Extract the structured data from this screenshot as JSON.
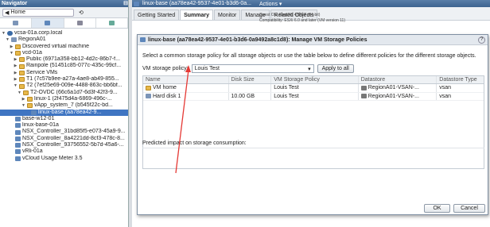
{
  "navigator": {
    "title": "Navigator",
    "home_label": "Home",
    "tree": [
      {
        "label": "vcsa-01a.corp.local",
        "icon": "vcenter-icon",
        "indent": 0,
        "expand": "▼"
      },
      {
        "label": "RegionA01",
        "icon": "datacenter-icon",
        "indent": 1,
        "expand": "▼"
      },
      {
        "label": "Discovered virtual machine",
        "icon": "folder-icon",
        "indent": 2,
        "expand": "▶"
      },
      {
        "label": "vcd-01a",
        "icon": "folder-icon",
        "indent": 2,
        "expand": "▼"
      },
      {
        "label": "Public (6971a358-bb12-4d2c-86b7-f...",
        "icon": "folder-icon",
        "indent": 3,
        "expand": "▶"
      },
      {
        "label": "Rainpole (51451c85-077c-435c-99cf...",
        "icon": "folder-icon",
        "indent": 3,
        "expand": "▶"
      },
      {
        "label": "Service VMs",
        "icon": "folder-icon",
        "indent": 3,
        "expand": "▶"
      },
      {
        "label": "T1 (7c57b9ee-a27a-4ae8-ab49-855...",
        "icon": "folder-icon",
        "indent": 3,
        "expand": "▶"
      },
      {
        "label": "T2 (7ef25e69-009e-4488-863c-bb6bf...",
        "icon": "folder-icon",
        "indent": 3,
        "expand": "▼"
      },
      {
        "label": "T2-OVDC (66c6a1d7-6d3f-42f3-9...",
        "icon": "folder-icon",
        "indent": 4,
        "expand": "▼"
      },
      {
        "label": "linux-1 (2f475d4a-6869-496c-...",
        "icon": "folder-icon",
        "indent": 5,
        "expand": "▶"
      },
      {
        "label": "vApp_system_7 (b545f22c-bd...",
        "icon": "folder-icon",
        "indent": 5,
        "expand": "▼"
      },
      {
        "label": "linux-base (aa78ea42-9...",
        "icon": "vm-icon",
        "indent": 6,
        "expand": "",
        "selected": true
      },
      {
        "label": "base-w12-01",
        "icon": "vm-icon",
        "indent": 2,
        "expand": ""
      },
      {
        "label": "linux-base-01a",
        "icon": "vm-icon",
        "indent": 2,
        "expand": ""
      },
      {
        "label": "NSX_Controller_31bd85f5-e073-45a9-9...",
        "icon": "vm-icon",
        "indent": 2,
        "expand": ""
      },
      {
        "label": "NSX_Controller_8a4221dd-8cf3-478c-8...",
        "icon": "vm-icon",
        "indent": 2,
        "expand": ""
      },
      {
        "label": "NSX_Controller_93756552-5b7d-45a6-...",
        "icon": "vm-icon",
        "indent": 2,
        "expand": ""
      },
      {
        "label": "vRli-01a",
        "icon": "vm-icon",
        "indent": 2,
        "expand": ""
      },
      {
        "label": "vCloud Usage Meter 3.5",
        "icon": "vm-icon",
        "indent": 2,
        "expand": ""
      }
    ]
  },
  "main": {
    "object_title": "linux-base (aa78ea42-9537-4e01-b3d6-0a...",
    "actions_label": "Actions ▾",
    "tabs": [
      "Getting Started",
      "Summary",
      "Monitor",
      "Manage",
      "Related Objects"
    ],
    "selected_tab": 1,
    "bg_lines": [
      "Guest OS:  CentOS 4/5/6/7 (64-bit)",
      "Compatibility:  ESXi 6.0 and later (VM version 11)"
    ]
  },
  "dialog": {
    "title": "linux-base (aa78ea42-9537-4e01-b3d6-0a9492a8c1d8): Manage VM Storage Policies",
    "instruction": "Select a common storage policy for all storage objects or use the table below to define different policies for the different storage objects.",
    "policy_label": "VM storage policy:",
    "policy_value": "Louis Test",
    "apply_label": "Apply to all",
    "columns": [
      "Name",
      "Disk Size",
      "VM Storage Policy",
      "Datastore",
      "Datastore Type"
    ],
    "rows": [
      {
        "name": "VM home",
        "icon": "folder-icon",
        "size": "",
        "policy": "Louis Test",
        "datastore": "RegionA01-VSAN-...",
        "type": "vsan"
      },
      {
        "name": "Hard disk 1",
        "icon": "disk-icon",
        "size": "10.00 GB",
        "policy": "Louis Test",
        "datastore": "RegionA01-VSAN-...",
        "type": "vsan"
      }
    ],
    "impact_label": "Predicted impact on storage consumption:",
    "ok_label": "OK",
    "cancel_label": "Cancel"
  },
  "annotation": {
    "color": "#e53935"
  }
}
